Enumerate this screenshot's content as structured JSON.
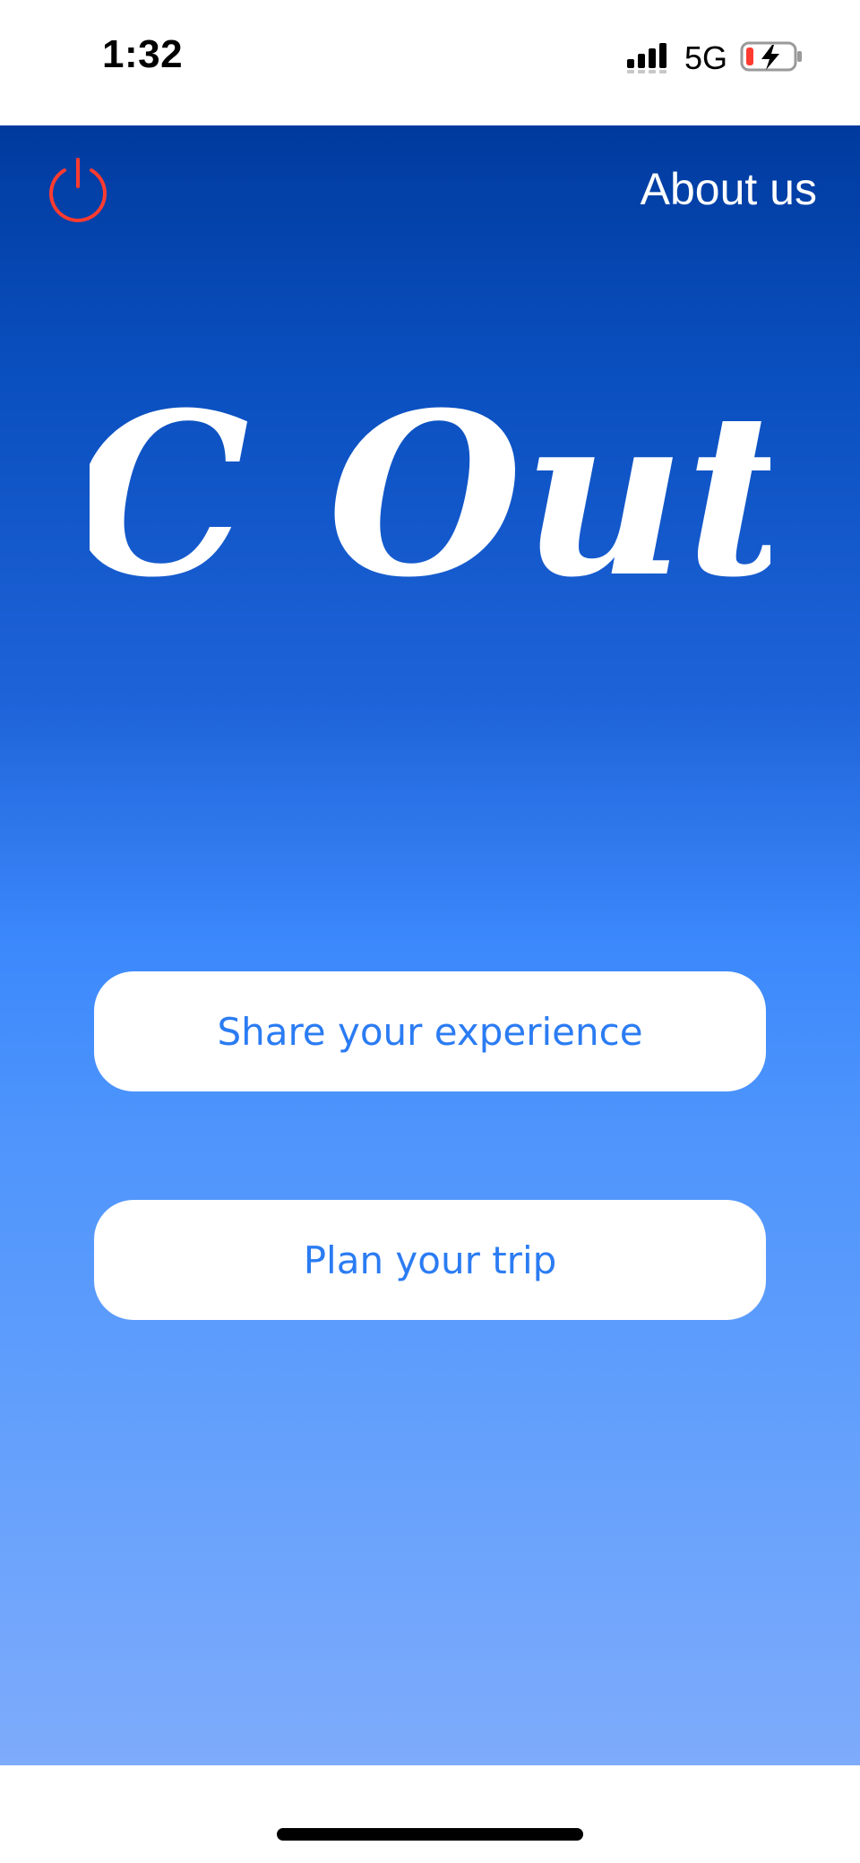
{
  "status_bar": {
    "time": "1:32",
    "network": "5G",
    "signal_icon": "cellular-signal-icon",
    "battery_icon": "battery-charging-icon",
    "battery_level_fraction": 0.1,
    "battery_color": "#ff3b30"
  },
  "header": {
    "power_icon": "power-icon",
    "power_color": "#ff3b30",
    "about_label": "About us"
  },
  "logo": {
    "text": "C Out"
  },
  "actions": {
    "share_label": "Share your experience",
    "plan_label": "Plan your trip"
  },
  "colors": {
    "gradient_top": "#003a9e",
    "gradient_bottom": "#7eabfb",
    "button_text": "#2b7cf3",
    "button_bg": "#ffffff"
  }
}
